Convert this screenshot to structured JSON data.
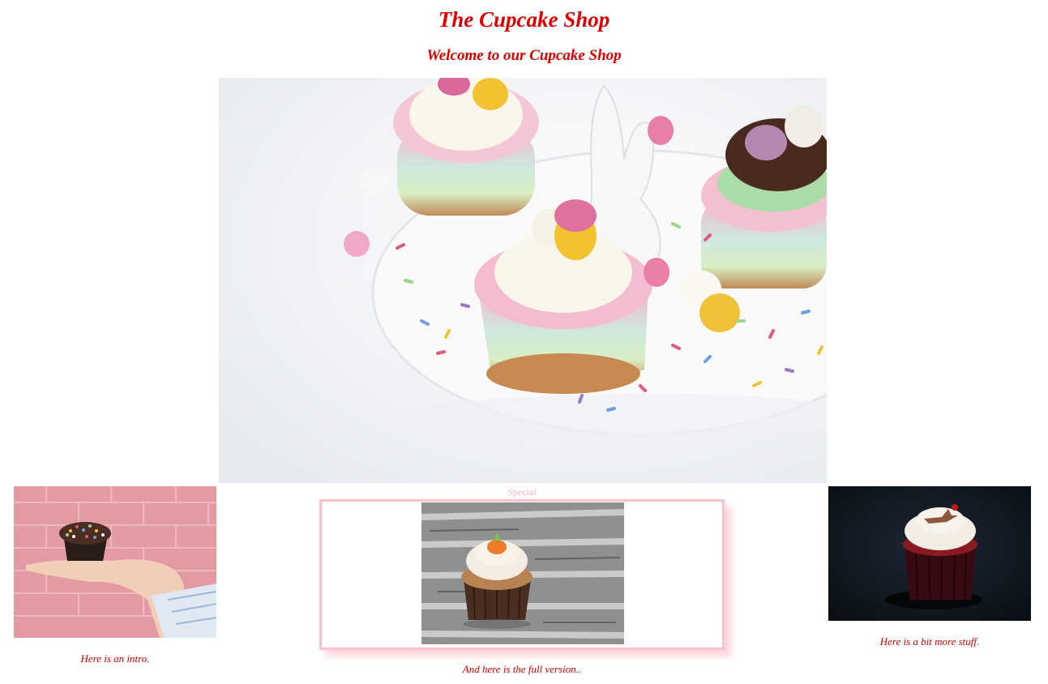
{
  "header": {
    "title": "The Cupcake Shop",
    "subtitle": "Welcome to our Cupcake Shop"
  },
  "hero": {
    "icon": "easter-cupcakes-photo"
  },
  "cards": {
    "left": {
      "icon": "sprinkle-cupcake-hand-photo",
      "caption": "Here is an intro."
    },
    "special": {
      "label": "Special",
      "icon": "carrot-cupcake-photo",
      "caption": "And here is the full version.."
    },
    "right": {
      "icon": "red-velvet-cupcake-photo",
      "caption": "Here is a bit more stuff."
    }
  },
  "colors": {
    "heading": "#e00000",
    "caption": "#cc0000",
    "special_border": "#ffc0cb",
    "special_label": "#f4b6c2"
  }
}
